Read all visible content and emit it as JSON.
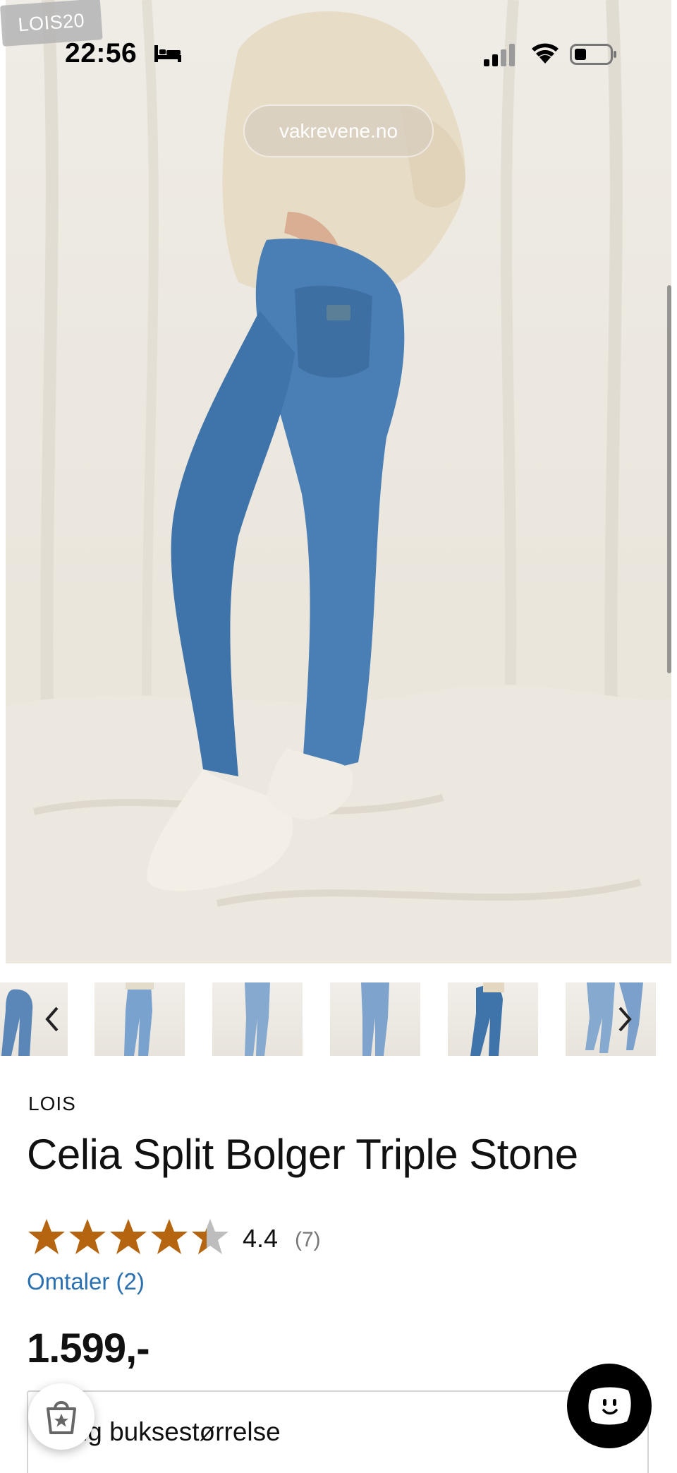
{
  "status_bar": {
    "time": "22:56",
    "icons": [
      "bed-icon",
      "signal-icon",
      "wifi-icon",
      "battery-icon"
    ]
  },
  "coupon": {
    "code": "LOIS20"
  },
  "browser": {
    "url": "vakrevene.no"
  },
  "gallery": {
    "thumbnail_count": 6,
    "selected_index": 4,
    "prev_icon": "chevron-left-icon",
    "next_icon": "chevron-right-icon"
  },
  "product": {
    "brand": "LOIS",
    "title": "Celia Split Bolger Triple Stone",
    "rating": {
      "value": "4.4",
      "count": "(7)",
      "stars_filled": 4.4,
      "stars_max": 5,
      "star_color": "#b5650f"
    },
    "reviews_link": "Omtaler (2)",
    "price": "1.599,-"
  },
  "size_selector": {
    "label": "Velg buksestørrelse",
    "visible_text": "ig buksestørrelse"
  },
  "floating": {
    "shop_icon": "shopping-bag-star-icon",
    "chat_icon": "chat-face-icon"
  },
  "colors": {
    "link": "#2a6fb0",
    "text": "#111111",
    "muted": "#777777",
    "chat_bg": "#000000"
  }
}
